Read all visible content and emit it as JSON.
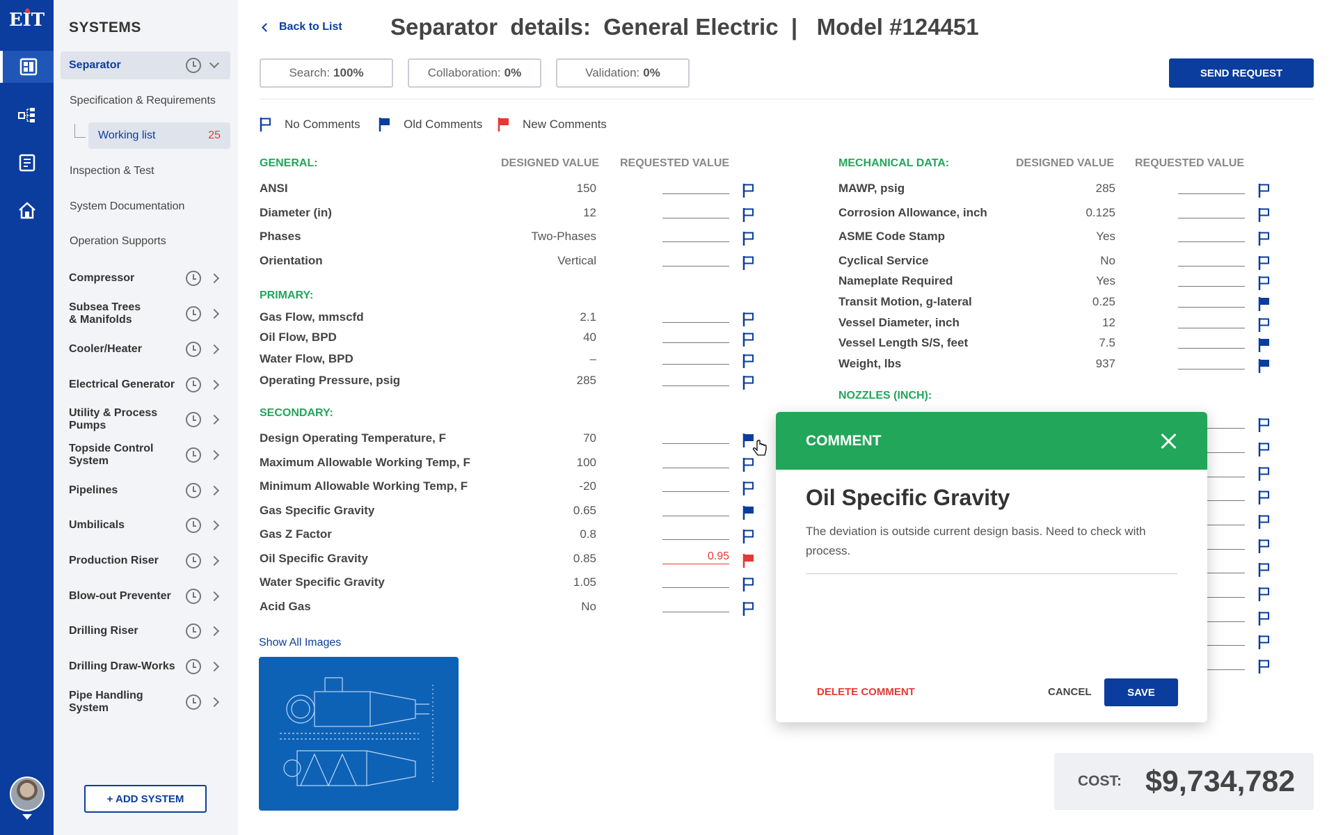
{
  "rail": {
    "logo": "EIT",
    "icons": [
      "dashboard-icon",
      "workflow-icon",
      "documents-icon",
      "home-icon"
    ],
    "accent": "#0a3d9e"
  },
  "sidebar": {
    "title": "SYSTEMS",
    "active_system": "Separator",
    "sub_items": [
      "Specification & Requirements",
      "Inspection & Test",
      "System Documentation",
      "Operation Supports"
    ],
    "working_list": {
      "label": "Working list",
      "count": "25"
    },
    "systems": [
      {
        "line1": "Compressor",
        "line2": ""
      },
      {
        "line1": "Subsea Trees",
        "line2": "& Manifolds"
      },
      {
        "line1": "Cooler/Heater",
        "line2": ""
      },
      {
        "line1": "Electrical Generator",
        "line2": ""
      },
      {
        "line1": "Utility & Process",
        "line2": "Pumps"
      },
      {
        "line1": "Topside Control",
        "line2": "System"
      },
      {
        "line1": "Pipelines",
        "line2": ""
      },
      {
        "line1": "Umbilicals",
        "line2": ""
      },
      {
        "line1": "Production Riser",
        "line2": ""
      },
      {
        "line1": "Blow-out Preventer",
        "line2": ""
      },
      {
        "line1": "Drilling Riser",
        "line2": ""
      },
      {
        "line1": "Drilling Draw-Works",
        "line2": ""
      },
      {
        "line1": "Pipe Handling",
        "line2": "System"
      }
    ],
    "add_button": "+ ADD SYSTEM"
  },
  "header": {
    "back": "Back to List",
    "title": "Separator  details:  General Electric  |   Model #124451",
    "pills": [
      {
        "label": "Search:",
        "value": "100%"
      },
      {
        "label": "Collaboration:",
        "value": "0%"
      },
      {
        "label": "Validation:",
        "value": "0%"
      }
    ],
    "send": "SEND REQUEST"
  },
  "legend": [
    "No Comments",
    "Old Comments",
    "New Comments"
  ],
  "colors": {
    "flag_blue": "#0a3d9e",
    "flag_red": "#e53935",
    "section_green": "#22a65a"
  },
  "columns": {
    "designed": "DESIGNED VALUE",
    "requested": "REQUESTED VALUE"
  },
  "left_sections": {
    "general": "GENERAL:",
    "primary": "PRIMARY:",
    "secondary": "SECONDARY:"
  },
  "general_rows": [
    {
      "name": "ANSI",
      "value": "150",
      "req": "",
      "flag": "none"
    },
    {
      "name": "Diameter (in)",
      "value": "12",
      "req": "",
      "flag": "none"
    },
    {
      "name": "Phases",
      "value": "Two-Phases",
      "req": "",
      "flag": "none"
    },
    {
      "name": "Orientation",
      "value": "Vertical",
      "req": "",
      "flag": "none"
    }
  ],
  "primary_rows": [
    {
      "name": "Gas Flow, mmscfd",
      "value": "2.1",
      "req": "",
      "flag": "none"
    },
    {
      "name": "Oil Flow, BPD",
      "value": "40",
      "req": "",
      "flag": "none"
    },
    {
      "name": "Water Flow, BPD",
      "value": "–",
      "req": "",
      "flag": "none"
    },
    {
      "name": "Operating Pressure, psig",
      "value": "285",
      "req": "",
      "flag": "none"
    }
  ],
  "secondary_rows": [
    {
      "name": "Design Operating Temperature, F",
      "value": "70",
      "req": "",
      "flag": "old"
    },
    {
      "name": "Maximum Allowable Working Temp, F",
      "value": "100",
      "req": "",
      "flag": "none"
    },
    {
      "name": "Minimum Allowable Working Temp, F",
      "value": "-20",
      "req": "",
      "flag": "none"
    },
    {
      "name": "Gas Specific Gravity",
      "value": "0.65",
      "req": "",
      "flag": "old"
    },
    {
      "name": "Gas Z Factor",
      "value": "0.8",
      "req": "",
      "flag": "none"
    },
    {
      "name": "Oil Specific Gravity",
      "value": "0.85",
      "req": "0.95",
      "flag": "new"
    },
    {
      "name": "Water Specific Gravity",
      "value": "1.05",
      "req": "",
      "flag": "none"
    },
    {
      "name": "Acid Gas",
      "value": "No",
      "req": "",
      "flag": "none"
    }
  ],
  "right_sections": {
    "mechanical": "MECHANICAL DATA:",
    "nozzles": "NOZZLES (INCH):"
  },
  "mechanical_rows": [
    {
      "name": "MAWP, psig",
      "value": "285",
      "req": "",
      "flag": "none"
    },
    {
      "name": "Corrosion Allowance, inch",
      "value": "0.125",
      "req": "",
      "flag": "none"
    },
    {
      "name": "ASME Code Stamp",
      "value": "Yes",
      "req": "",
      "flag": "none"
    },
    {
      "name": "Cyclical Service",
      "value": "No",
      "req": "",
      "flag": "none"
    },
    {
      "name": "Nameplate Required",
      "value": "Yes",
      "req": "",
      "flag": "none"
    },
    {
      "name": "Transit Motion, g-lateral",
      "value": "0.25",
      "req": "",
      "flag": "old"
    },
    {
      "name": "Vessel Diameter, inch",
      "value": "12",
      "req": "",
      "flag": "none"
    },
    {
      "name": "Vessel Length S/S, feet",
      "value": "7.5",
      "req": "",
      "flag": "old"
    },
    {
      "name": "Weight, lbs",
      "value": "937",
      "req": "",
      "flag": "old"
    }
  ],
  "nozzle_flag_count": 11,
  "images": {
    "link": "Show All Images"
  },
  "cost": {
    "label": "COST:",
    "amount": "$9,734,782"
  },
  "modal": {
    "header": "COMMENT",
    "title": "Oil Specific Gravity",
    "text": "The deviation is outside current design basis. Need to check with process.",
    "delete": "DELETE COMMENT",
    "cancel": "CANCEL",
    "save": "SAVE"
  }
}
